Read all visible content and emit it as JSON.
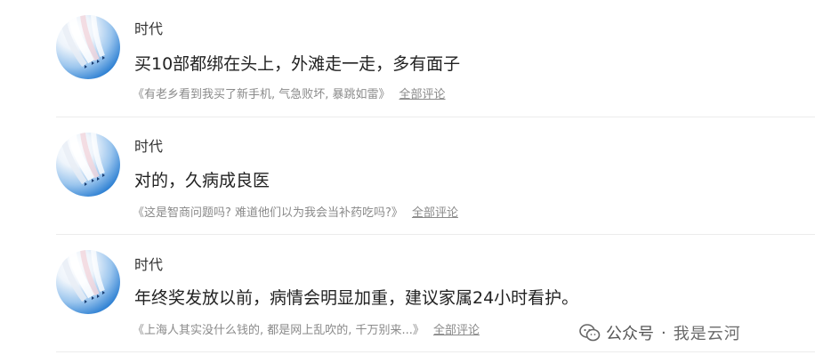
{
  "comments": [
    {
      "username": "时代",
      "content": "买10部都绑在头上，外滩走一走，多有面子",
      "reference": "《有老乡看到我买了新手机, 气急败坏, 暴跳如雷》",
      "all_comments_label": "全部评论"
    },
    {
      "username": "时代",
      "content": "对的，久病成良医",
      "reference": "《这是智商问题吗? 难道他们以为我会当补药吃吗?》",
      "all_comments_label": "全部评论"
    },
    {
      "username": "时代",
      "content": "年终奖发放以前，病情会明显加重，建议家属24小时看护。",
      "reference": "《上海人其实没什么钱的, 都是网上乱吹的, 千万别来...》",
      "all_comments_label": "全部评论"
    }
  ],
  "watermark": {
    "platform": "公众号",
    "separator": "·",
    "account": "我是云河"
  },
  "colors": {
    "text_primary": "#222222",
    "text_secondary": "#8a8a8a",
    "divider": "#ececec",
    "avatar_sky": "#2c7fd2"
  }
}
